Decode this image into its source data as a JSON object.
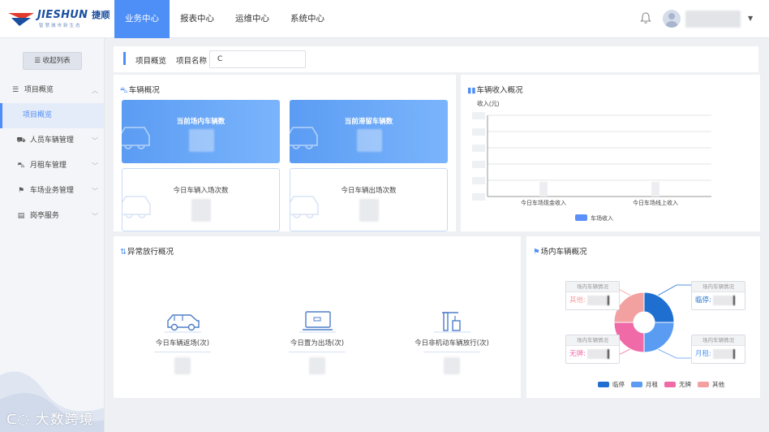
{
  "header": {
    "logo_brand": "JIESHUN",
    "logo_cn": "捷顺",
    "logo_slogan": "智慧城市新生态",
    "nav": [
      {
        "label": "业务中心",
        "active": true
      },
      {
        "label": "报表中心",
        "active": false
      },
      {
        "label": "运维中心",
        "active": false
      },
      {
        "label": "系统中心",
        "active": false
      }
    ],
    "icons": {
      "bell": "bell-icon",
      "avatar": "user-avatar-icon",
      "caret": "caret-down-icon"
    }
  },
  "sidebar": {
    "collapse_label": "收起列表",
    "items": [
      {
        "label": "项目概览",
        "icon": "list-icon",
        "expanded": true
      },
      {
        "label": "项目概览",
        "icon": "",
        "active": true
      },
      {
        "label": "人员车辆管理",
        "icon": "people-car-icon"
      },
      {
        "label": "月租车管理",
        "icon": "car-icon"
      },
      {
        "label": "车场业务管理",
        "icon": "parking-business-icon"
      },
      {
        "label": "岗亭服务",
        "icon": "booth-icon"
      }
    ],
    "watermark": "大数跨境"
  },
  "crumb": {
    "title": "项目概览",
    "project_label": "项目名称",
    "project_value": "C"
  },
  "vehicle_panel": {
    "title": "车辆概况",
    "cards": [
      {
        "label": "当前场内车辆数",
        "style": "blue"
      },
      {
        "label": "当前滞留车辆数",
        "style": "blue"
      },
      {
        "label": "今日车辆入场次数",
        "style": "white"
      },
      {
        "label": "今日车辆出场次数",
        "style": "white"
      }
    ]
  },
  "income_panel": {
    "title": "车辆收入概况",
    "chart_data": {
      "type": "bar",
      "title": "",
      "ylabel": "收入(元)",
      "categories": [
        "今日车场现金收入",
        "今日车场线上收入"
      ],
      "series": [
        {
          "name": "车场收入",
          "values": [
            null,
            null
          ],
          "color": "#5b8ff9"
        }
      ],
      "grid": true,
      "legend": "bottom"
    }
  },
  "abnormal_panel": {
    "title": "异常放行概况",
    "items": [
      {
        "label": "今日车辆返场(次)",
        "icon": "car-outline-icon"
      },
      {
        "label": "今日置为出场(次)",
        "icon": "monitor-icon"
      },
      {
        "label": "今日非机动车辆放行(次)",
        "icon": "gate-icon"
      }
    ]
  },
  "parking_panel": {
    "title": "场内车辆概况",
    "tooltip_head": "场内车辆情况",
    "tooltips": [
      {
        "label": "其他:",
        "color": "#f3a0a0"
      },
      {
        "label": "临停:",
        "color": "#1f6fd1"
      },
      {
        "label": "无牌:",
        "color": "#f06aa8"
      },
      {
        "label": "月租:",
        "color": "#5b9cf3"
      }
    ],
    "chart_data": {
      "type": "pie",
      "title": "",
      "categories": [
        "临停",
        "月租",
        "无牌",
        "其他"
      ],
      "values": [
        25,
        25,
        25,
        25
      ],
      "colors": [
        "#1f6fd1",
        "#5b9cf3",
        "#f06aa8",
        "#f3a0a0"
      ],
      "legend": "bottom"
    },
    "legend": [
      {
        "label": "临停",
        "color": "#1f6fd1"
      },
      {
        "label": "月租",
        "color": "#5b9cf3"
      },
      {
        "label": "无牌",
        "color": "#f06aa8"
      },
      {
        "label": "其他",
        "color": "#f3a0a0"
      }
    ]
  }
}
